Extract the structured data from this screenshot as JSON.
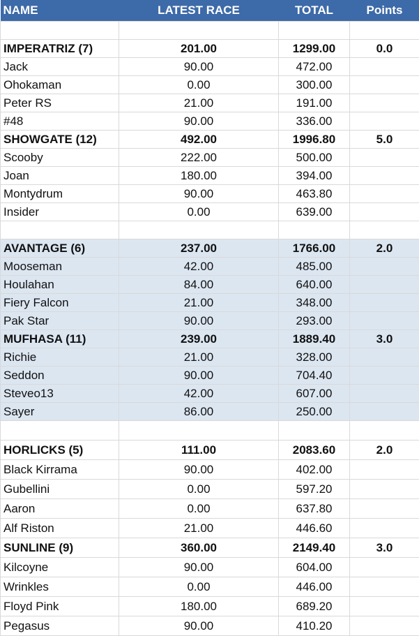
{
  "headers": {
    "name": "NAME",
    "latest": "LATEST RACE",
    "total": "TOTAL",
    "points": "Points"
  },
  "rows": [
    {
      "name": "",
      "latest": "",
      "total": "",
      "points": "",
      "bold": false,
      "blue": false
    },
    {
      "name": "IMPERATRIZ (7)",
      "latest": "201.00",
      "total": "1299.00",
      "points": "0.0",
      "bold": true,
      "blue": false
    },
    {
      "name": "Jack",
      "latest": "90.00",
      "total": "472.00",
      "points": "",
      "bold": false,
      "blue": false
    },
    {
      "name": "Ohokaman",
      "latest": "0.00",
      "total": "300.00",
      "points": "",
      "bold": false,
      "blue": false
    },
    {
      "name": "Peter RS",
      "latest": "21.00",
      "total": "191.00",
      "points": "",
      "bold": false,
      "blue": false
    },
    {
      "name": "#48",
      "latest": "90.00",
      "total": "336.00",
      "points": "",
      "bold": false,
      "blue": false
    },
    {
      "name": "SHOWGATE (12)",
      "latest": "492.00",
      "total": "1996.80",
      "points": "5.0",
      "bold": true,
      "blue": false
    },
    {
      "name": "Scooby",
      "latest": "222.00",
      "total": "500.00",
      "points": "",
      "bold": false,
      "blue": false
    },
    {
      "name": "Joan",
      "latest": "180.00",
      "total": "394.00",
      "points": "",
      "bold": false,
      "blue": false
    },
    {
      "name": "Montydrum",
      "latest": "90.00",
      "total": "463.80",
      "points": "",
      "bold": false,
      "blue": false
    },
    {
      "name": "Insider",
      "latest": "0.00",
      "total": "639.00",
      "points": "",
      "bold": false,
      "blue": false
    },
    {
      "name": "",
      "latest": "",
      "total": "",
      "points": "",
      "bold": false,
      "blue": false
    },
    {
      "name": "AVANTAGE (6)",
      "latest": "237.00",
      "total": "1766.00",
      "points": "2.0",
      "bold": true,
      "blue": true
    },
    {
      "name": "Mooseman",
      "latest": "42.00",
      "total": "485.00",
      "points": "",
      "bold": false,
      "blue": true
    },
    {
      "name": "Houlahan",
      "latest": "84.00",
      "total": "640.00",
      "points": "",
      "bold": false,
      "blue": true
    },
    {
      "name": "Fiery Falcon",
      "latest": "21.00",
      "total": "348.00",
      "points": "",
      "bold": false,
      "blue": true
    },
    {
      "name": "Pak Star",
      "latest": "90.00",
      "total": "293.00",
      "points": "",
      "bold": false,
      "blue": true
    },
    {
      "name": "MUFHASA (11)",
      "latest": "239.00",
      "total": "1889.40",
      "points": "3.0",
      "bold": true,
      "blue": true
    },
    {
      "name": "Richie",
      "latest": "21.00",
      "total": "328.00",
      "points": "",
      "bold": false,
      "blue": true
    },
    {
      "name": "Seddon",
      "latest": "90.00",
      "total": "704.40",
      "points": "",
      "bold": false,
      "blue": true
    },
    {
      "name": "Steveo13",
      "latest": "42.00",
      "total": "607.00",
      "points": "",
      "bold": false,
      "blue": true
    },
    {
      "name": "Sayer",
      "latest": "86.00",
      "total": "250.00",
      "points": "",
      "bold": false,
      "blue": true
    },
    {
      "name": "",
      "latest": "",
      "total": "",
      "points": "",
      "bold": false,
      "blue": false
    },
    {
      "name": "HORLICKS (5)",
      "latest": "111.00",
      "total": "2083.60",
      "points": "2.0",
      "bold": true,
      "blue": false
    },
    {
      "name": "Black Kirrama",
      "latest": "90.00",
      "total": "402.00",
      "points": "",
      "bold": false,
      "blue": false
    },
    {
      "name": "Gubellini",
      "latest": "0.00",
      "total": "597.20",
      "points": "",
      "bold": false,
      "blue": false
    },
    {
      "name": "Aaron",
      "latest": "0.00",
      "total": "637.80",
      "points": "",
      "bold": false,
      "blue": false
    },
    {
      "name": "Alf Riston",
      "latest": "21.00",
      "total": "446.60",
      "points": "",
      "bold": false,
      "blue": false
    },
    {
      "name": "SUNLINE (9)",
      "latest": "360.00",
      "total": "2149.40",
      "points": "3.0",
      "bold": true,
      "blue": false
    },
    {
      "name": "Kilcoyne",
      "latest": "90.00",
      "total": "604.00",
      "points": "",
      "bold": false,
      "blue": false
    },
    {
      "name": "Wrinkles",
      "latest": "0.00",
      "total": "446.00",
      "points": "",
      "bold": false,
      "blue": false
    },
    {
      "name": "Floyd Pink",
      "latest": "180.00",
      "total": "689.20",
      "points": "",
      "bold": false,
      "blue": false
    },
    {
      "name": "Pegasus",
      "latest": "90.00",
      "total": "410.20",
      "points": "",
      "bold": false,
      "blue": false
    }
  ]
}
